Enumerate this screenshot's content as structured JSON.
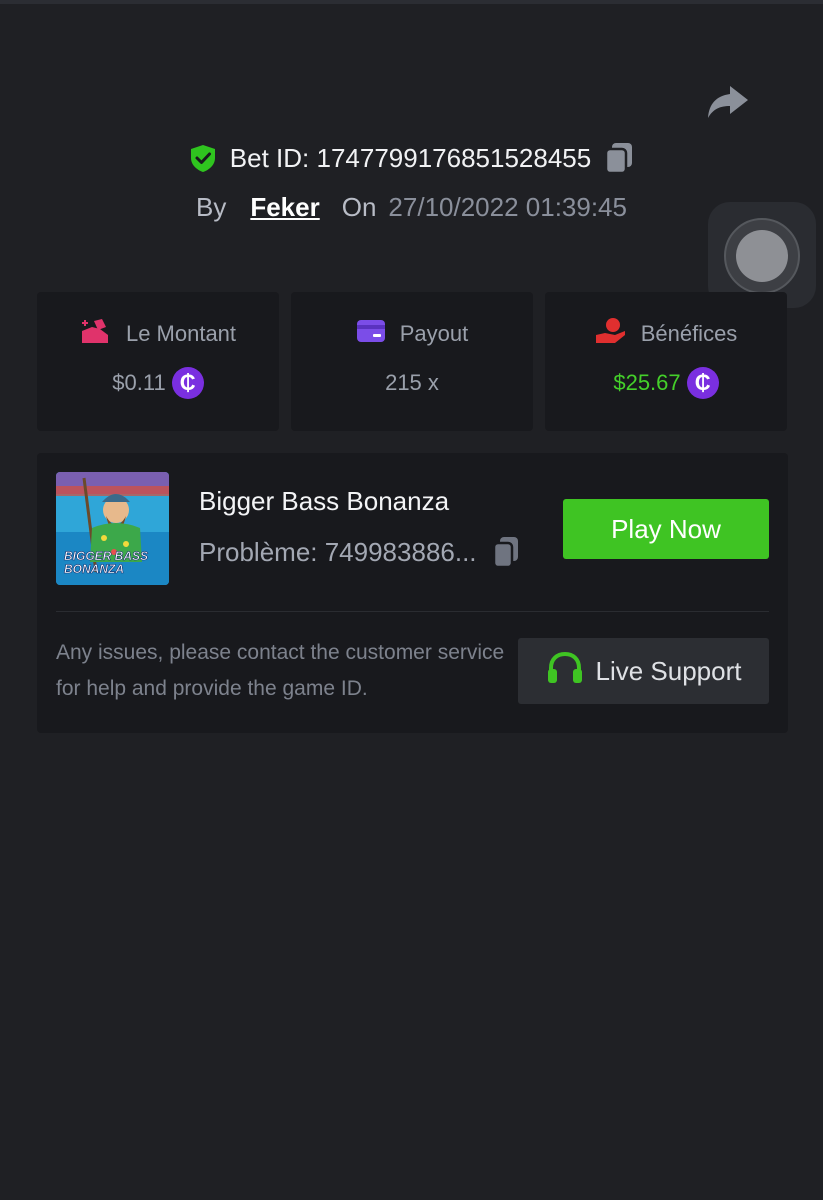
{
  "colors": {
    "background": "#1f2024",
    "card": "#18191d",
    "accent_green": "#3fc423",
    "profit_green": "#44d02a",
    "coin_purple": "#7a2fe0"
  },
  "header": {
    "share_icon": "share-arrow-icon",
    "bet_id_label": "Bet ID: 1747799176851528455",
    "by_label": "By",
    "username": "Feker",
    "on_label": "On",
    "datetime": "27/10/2022 01:39:45"
  },
  "stats": [
    {
      "icon": "money-hand-icon",
      "label": "Le Montant",
      "value": "$0.11",
      "currency_icon": "coin-icon",
      "currency_symbol": "₵"
    },
    {
      "icon": "card-icon",
      "label": "Payout",
      "value": "215 x"
    },
    {
      "icon": "profit-hand-icon",
      "label": "Bénéfices",
      "value": "$25.67",
      "currency_icon": "coin-icon",
      "currency_symbol": "₵"
    }
  ],
  "game": {
    "title": "Bigger Bass Bonanza",
    "thumbnail_text_line1": "BIGGER BASS",
    "thumbnail_text_line2": "BONANZA",
    "issue_label": "Problème: 749983886...",
    "play_button": "Play Now",
    "help_text": "Any issues, please contact the customer service for help and provide the game ID.",
    "support_button": "Live Support"
  }
}
